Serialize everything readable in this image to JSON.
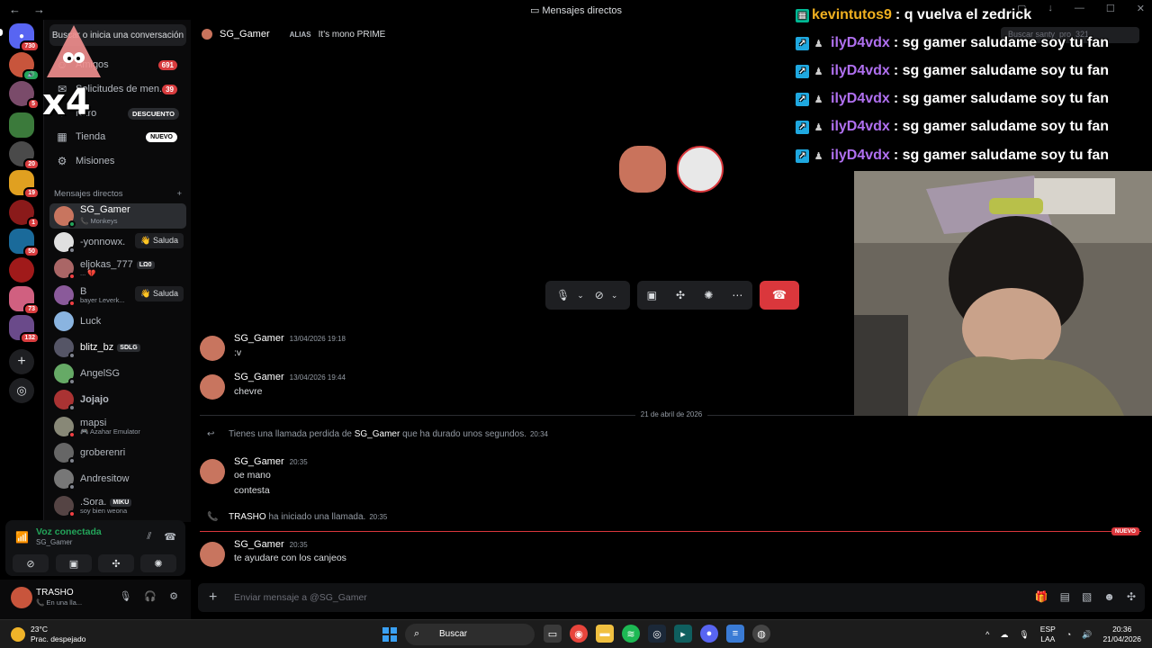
{
  "window": {
    "title": "Mensajes directos",
    "nav_back": "←",
    "nav_forward": "→"
  },
  "guilds": [
    {
      "name": "discord-home",
      "badge": "730",
      "color": "#5865f2"
    },
    {
      "name": "guild-1",
      "badge": "",
      "color": "#c8553c"
    },
    {
      "name": "guild-2",
      "badge": "5",
      "color": "#7a4b6a"
    },
    {
      "name": "guild-3",
      "badge": "",
      "color": "#3b7a3b"
    },
    {
      "name": "guild-4",
      "badge": "20",
      "color": "#4a4a4a"
    },
    {
      "name": "guild-5",
      "badge": "19",
      "color": "#e0a020"
    },
    {
      "name": "guild-6",
      "badge": "1",
      "color": "#8a1a1a"
    },
    {
      "name": "guild-7",
      "badge": "50",
      "color": "#1a6a9a"
    },
    {
      "name": "guild-8",
      "badge": "",
      "color": "#a01a1a"
    },
    {
      "name": "guild-9",
      "badge": "73",
      "color": "#d06080"
    },
    {
      "name": "guild-10",
      "badge": "132",
      "color": "#6a4a8a"
    }
  ],
  "sidebar": {
    "search_label": "Buscar o inicia una conversación",
    "nav": [
      {
        "label": "Amigos",
        "count": "691"
      },
      {
        "label": "Solicitudes de men...",
        "count": "39"
      },
      {
        "label": "Nitro",
        "pill": "DESCUENTO"
      },
      {
        "label": "Tienda",
        "pill": "NUEVO"
      },
      {
        "label": "Misiones",
        "pill": ""
      }
    ],
    "dm_header": "Mensajes directos",
    "dm_add": "+",
    "dms": [
      {
        "name": "SG_Gamer",
        "sub": "Monkeys",
        "active": true,
        "color": "#c8755f",
        "status": "#23a55a"
      },
      {
        "name": "-yonnowx.",
        "sub": "",
        "action": "👋 Saluda",
        "color": "#e0e0e0",
        "status": "#80848e"
      },
      {
        "name": "eljokas_777",
        "sub": "... 💔",
        "tag": "LΩ0",
        "color": "#a66",
        "status": "#f23f43"
      },
      {
        "name": "B",
        "sub": "bayer Leverk...",
        "action": "👋 Saluda",
        "color": "#8a5a9a",
        "status": "#f23f43"
      },
      {
        "name": "Luck",
        "sub": "",
        "color": "#8ab4e0",
        "status": ""
      },
      {
        "name": "blitz_bz",
        "sub": "",
        "tag": "SDLG",
        "color": "#556",
        "status": "#80848e"
      },
      {
        "name": "AngelSG",
        "sub": "",
        "color": "#6a6",
        "status": "#80848e"
      },
      {
        "name": "Jojajo",
        "sub": "",
        "color": "#a33",
        "status": "#80848e"
      },
      {
        "name": "mapsi",
        "sub": "Azahar Emulator",
        "color": "#887",
        "status": "#f23f43"
      },
      {
        "name": "groberenri",
        "sub": "",
        "color": "#666",
        "status": "#80848e"
      },
      {
        "name": "Andresitow",
        "sub": "",
        "color": "#777",
        "status": "#80848e"
      },
      {
        "name": ".Sora.",
        "sub": "soy bien weona",
        "tag": "MIKU",
        "color": "#544",
        "status": "#f23f43"
      }
    ]
  },
  "voice": {
    "status": "Voz conectada",
    "channel": "SG_Gamer"
  },
  "user": {
    "name": "TRASHO",
    "status": "En una lla..."
  },
  "header": {
    "name": "SG_Gamer",
    "alias_label": "ALIAS",
    "alias_value": "It's mono PRIME",
    "search_placeholder": "Buscar santy_pro_321"
  },
  "messages": {
    "m1": {
      "author": "SG_Gamer",
      "time": "13/04/2026 19:18",
      "lines": [
        ":v"
      ]
    },
    "m2": {
      "author": "SG_Gamer",
      "time": "13/04/2026 19:44",
      "lines": [
        "chevre"
      ]
    },
    "date_divider": "21 de abril de 2026",
    "missed": {
      "pre": "Tienes una llamada perdida de ",
      "who": "SG_Gamer",
      "post": " que ha durado unos segundos.",
      "time": "20:34"
    },
    "m3": {
      "author": "SG_Gamer",
      "time": "20:35",
      "lines": [
        "oe mano",
        "contesta"
      ]
    },
    "started": {
      "who": "TRASHO",
      "post": " ha iniciado una llamada.",
      "time": "20:35"
    },
    "new_label": "NUEVO",
    "m4": {
      "author": "SG_Gamer",
      "time": "20:35",
      "lines": [
        "te ayudare con los canjeos"
      ]
    }
  },
  "composer": {
    "placeholder": "Enviar mensaje a @SG_Gamer"
  },
  "stream_chat": [
    {
      "user": "kevintutos9",
      "msg": ": q vuelva el zedrick",
      "color": "#f0b020"
    },
    {
      "user": "ilyD4vdx",
      "msg": ": sg gamer saludame soy tu fan",
      "color": "#b070f0"
    },
    {
      "user": "ilyD4vdx",
      "msg": ": sg gamer saludame soy tu fan",
      "color": "#b070f0"
    },
    {
      "user": "ilyD4vdx",
      "msg": ": sg gamer saludame soy tu fan",
      "color": "#b070f0"
    },
    {
      "user": "ilyD4vdx",
      "msg": ": sg gamer saludame soy tu fan",
      "color": "#b070f0"
    },
    {
      "user": "ilyD4vdx",
      "msg": ": sg gamer saludame soy tu fan",
      "color": "#b070f0"
    }
  ],
  "meme_text": "x4",
  "taskbar": {
    "temp": "23°C",
    "weather": "Prac. despejado",
    "search": "Buscar",
    "lang1": "ESP",
    "lang2": "LAA",
    "time": "20:36",
    "date": "21/04/2026"
  }
}
